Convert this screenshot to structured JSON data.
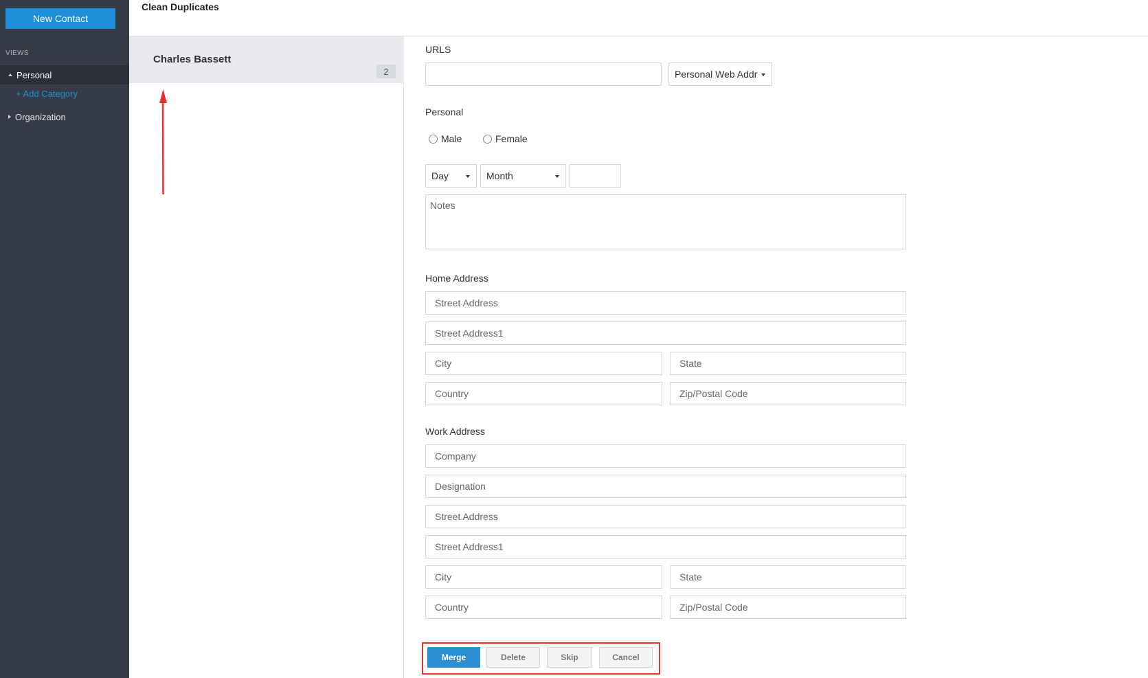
{
  "sidebar": {
    "new_contact_label": "New Contact",
    "views_label": "VIEWS",
    "personal_label": "Personal",
    "add_category_label": "+ Add Category",
    "organization_label": "Organization"
  },
  "header": {
    "title": "Clean Duplicates"
  },
  "duplicates": {
    "name": "Charles Bassett",
    "count": "2"
  },
  "form": {
    "urls_label": "URLS",
    "url_type": "Personal Web Addr",
    "personal_label": "Personal",
    "gender_options": [
      "Male",
      "Female"
    ],
    "day_label": "Day",
    "month_label": "Month",
    "notes_placeholder": "Notes",
    "home_address_label": "Home Address",
    "home": {
      "street": "Street Address",
      "street1": "Street Address1",
      "city": "City",
      "state": "State",
      "country": "Country",
      "zip": "Zip/Postal Code"
    },
    "work_address_label": "Work Address",
    "work": {
      "company": "Company",
      "designation": "Designation",
      "street": "Street Address",
      "street1": "Street Address1",
      "city": "City",
      "state": "State",
      "country": "Country",
      "zip": "Zip/Postal Code"
    }
  },
  "actions": {
    "merge": "Merge",
    "delete": "Delete",
    "skip": "Skip",
    "cancel": "Cancel"
  },
  "colors": {
    "accent": "#1e8fd6",
    "sidebar_bg": "#363c47",
    "annotation": "#e8322a"
  }
}
